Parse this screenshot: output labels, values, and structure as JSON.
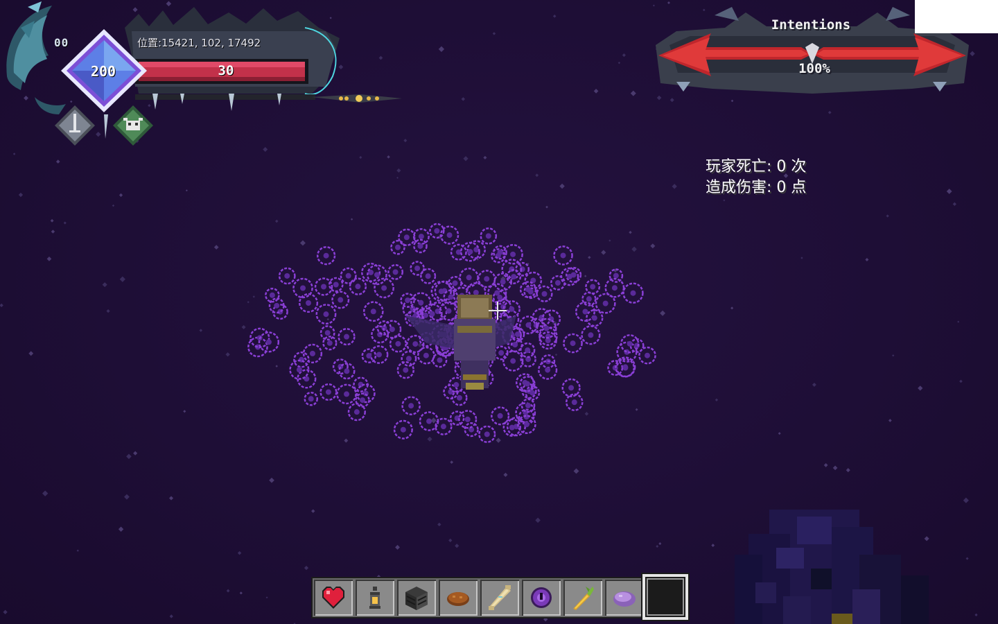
{
  "hud": {
    "level_label": "00",
    "position_text": "位置:15421, 102, 17492",
    "mana_value": "200",
    "health_value": "30",
    "icons": [
      "sword-icon",
      "cow-icon"
    ]
  },
  "boss_bar": {
    "name": "Intentions",
    "percent": "100%"
  },
  "stats": {
    "deaths": "玩家死亡: 0 次",
    "damage": "造成伤害: 0 点"
  },
  "hotbar": {
    "items": [
      "heart-icon",
      "lantern-icon",
      "stone-bricks-icon",
      "bread-icon",
      "bone-icon",
      "ender-pearl-icon",
      "golden-carrot-icon",
      "purple-cloud-icon",
      "empty-slot"
    ],
    "selected_index": 8
  },
  "colors": {
    "background": "#1e0e36",
    "particles": "#8a3fd6",
    "health": "#d3334f",
    "mana_crystal": "#7a6ad6",
    "boss_bar": "#b3222a"
  }
}
